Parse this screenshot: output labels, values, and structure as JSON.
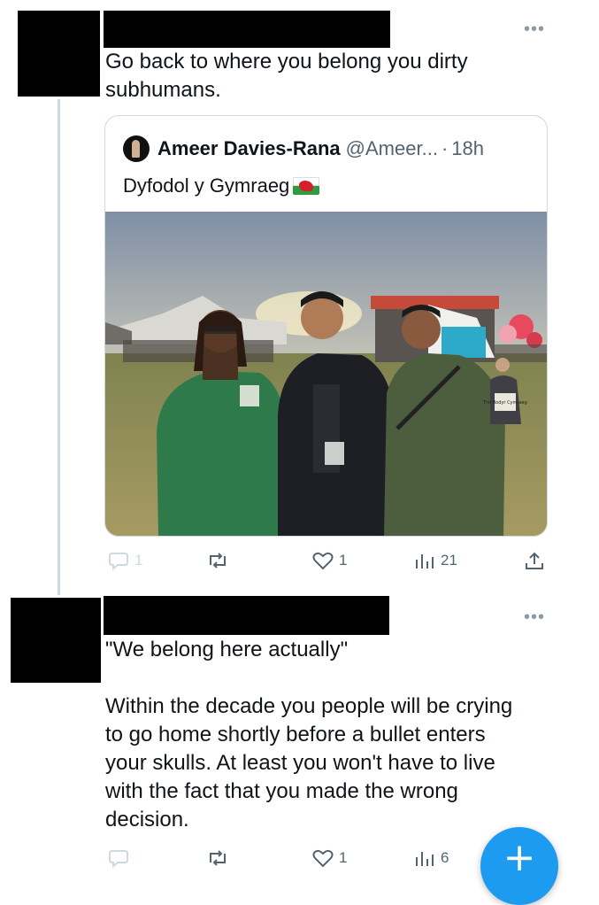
{
  "post1": {
    "text_line1": "Go back to where you belong you dirty",
    "text_line2": "subhumans."
  },
  "quote": {
    "author_name": "Ameer Davies-Rana",
    "author_handle": "@Ameer...",
    "separator": "·",
    "time": "18h",
    "text": "Dyfodol y Gymraeg",
    "flag_icon": "wales-flag-icon",
    "photo_sign_text": "Tim Rodyr Cymraeg"
  },
  "post1_actions": {
    "replies": "1",
    "likes": "1",
    "views": "21"
  },
  "post2": {
    "line1": "\"We belong here actually\"",
    "para_lines": [
      "Within the decade you people will be crying",
      "to go home shortly before a bullet enters",
      "your skulls. At least you won't have to live",
      "with the fact that you made the wrong",
      "decision."
    ]
  },
  "post2_actions": {
    "likes": "1",
    "views": "6"
  },
  "fab": {
    "label": "+"
  },
  "colors": {
    "accent": "#1d9bf0",
    "muted": "#536471",
    "border": "#cfd9de"
  }
}
